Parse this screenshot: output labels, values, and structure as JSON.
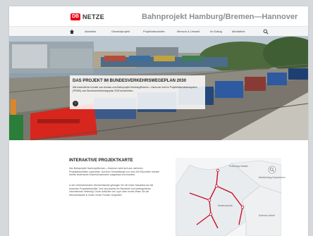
{
  "header": {
    "logo_text": "DB",
    "brand": "NETZE",
    "project_title": "Bahnprojekt Hamburg/Bremen—Hannover"
  },
  "nav": {
    "items": [
      "Aktuelles",
      "Gesamtprojekt",
      "Projektabschnitte",
      "Mensch & Umwelt",
      "Im Dialog",
      "Mediathek"
    ]
  },
  "hero": {
    "title": "DAS PROJEKT IM BUNDESVERKEHRSWEGEPLAN 2030",
    "text": "Alle wesentlichen Inhalte zum Ausbau zum Bahnprojekt Hamburg/Bremen—Hannover sind im Projektinformationssystem (PRINS) zum Bundesverkehrswegeplan 2030 beschrieben.",
    "arrow": "›"
  },
  "section": {
    "title": "INTERAKTIVE PROJEKTKARTE",
    "p1": "Das Bahnprojekt Hamburg/Bremen—Hannover setzt sich aus mehreren Projektabschnitten zusammen. Auf einer Gesamtlänge von rund 440 Kilometern werden bereits bestehende Eisenbahnstrecken ausgebaut und erweitert.",
    "p2": "In der nebenstehenden Übersichtskarte gelangen Sie mit einem Mausklick auf die einzelnen Projektabschnitte. Dort sind jeweils ein Steckbrief und weitergehende Informationen hinterlegt. Durch Anklicken der Lupe oben rechts öffnen Sie die Übersichtskarte in einem neuen Fenster vergrößert."
  },
  "map": {
    "labels": [
      "Schleswig-Holstein",
      "Mecklenburg-Vorpommern",
      "Niedersachsen",
      "Sachsen-Anhalt"
    ]
  },
  "colors": {
    "db_red": "#ec0016",
    "title_gray": "#8a8f94",
    "map_route": "#c8102e"
  }
}
